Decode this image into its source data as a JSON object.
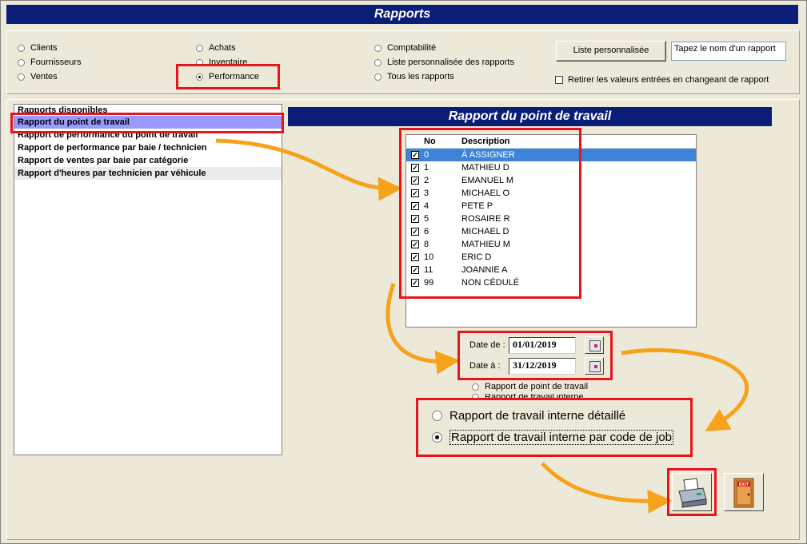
{
  "window": {
    "title": "Rapports"
  },
  "categories": {
    "col1": [
      "Clients",
      "Fournisseurs",
      "Ventes"
    ],
    "col2": [
      "Achats",
      "Inventaire",
      "Performance"
    ],
    "col3": [
      "Comptabilité",
      "Liste personnalisée des rapports",
      "Tous les rapports"
    ],
    "selected": "Performance"
  },
  "toolbar": {
    "custom_list_label": "Liste personnalisée",
    "report_name_value": "Tapez le nom d'un rapport",
    "clear_values_label": "Retirer les valeurs entrées en changeant de rapport"
  },
  "reports_list": {
    "header": "Rapports disponibles",
    "items": [
      "Rapport du point de travail",
      "Rapport de performance du point de travail",
      "Rapport de performance par baie / technicien",
      "Rapport de ventes par baie par catégorie",
      "Rapport d'heures par technicien par véhicule"
    ],
    "selected_index": 0
  },
  "report_panel": {
    "title": "Rapport du point de travail",
    "grid_headers": {
      "no": "No",
      "description": "Description"
    },
    "rows": [
      {
        "no": "0",
        "desc": "À ASSIGNER"
      },
      {
        "no": "1",
        "desc": "MATHIEU D"
      },
      {
        "no": "2",
        "desc": "EMANUEL M"
      },
      {
        "no": "3",
        "desc": "MICHAEL O"
      },
      {
        "no": "4",
        "desc": "PETE P"
      },
      {
        "no": "5",
        "desc": "ROSAIRE R"
      },
      {
        "no": "6",
        "desc": "MICHAEL D"
      },
      {
        "no": "8",
        "desc": "MATHIEU M"
      },
      {
        "no": "10",
        "desc": "ERIC D"
      },
      {
        "no": "11",
        "desc": "JOANNIE A"
      },
      {
        "no": "99",
        "desc": "NON CÉDULÉ"
      }
    ],
    "date_from_label": "Date de :",
    "date_from": "01/01/2019",
    "date_to_label": "Date à :",
    "date_to": "31/12/2019",
    "small_options": [
      "Rapport de point de travail",
      "Rapport de travail interne"
    ],
    "big_options": [
      "Rapport de travail interne détaillé",
      "Rapport de travail interne par code de job"
    ],
    "big_selected_index": 1,
    "exit_label": "EXIT"
  },
  "colors": {
    "title_bar": "#0a1e78",
    "highlight": "#e8141c",
    "arrow": "#f7a21b",
    "selected_row": "#3d83d8"
  }
}
